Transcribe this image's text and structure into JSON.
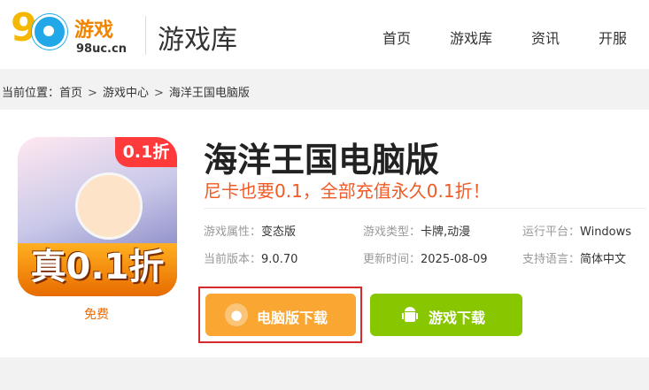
{
  "header": {
    "logo_big": "9",
    "logo_cn": "游戏",
    "logo_url": "98uc.cn",
    "site_title": "游戏库",
    "nav": [
      "首页",
      "游戏库",
      "资讯",
      "开服"
    ]
  },
  "breadcrumb": {
    "prefix": "当前位置：",
    "items": [
      "首页",
      "游戏中心",
      "海洋王国电脑版"
    ],
    "separator": ">"
  },
  "game": {
    "icon_tag": "0.1折",
    "icon_big": "真0.1折",
    "price": "免费",
    "title": "海洋王国电脑版",
    "promo": "尼卡也要0.1，全部充值永久0.1折！",
    "meta": [
      {
        "label": "游戏属性：",
        "value": "变态版"
      },
      {
        "label": "游戏类型：",
        "value": "卡牌,动漫"
      },
      {
        "label": "运行平台：",
        "value": "Windows"
      },
      {
        "label": "当前版本：",
        "value": "9.0.70"
      },
      {
        "label": "更新时间：",
        "value": "2025-08-09"
      },
      {
        "label": "支持语言：",
        "value": "简体中文"
      }
    ]
  },
  "buttons": {
    "pc_download": "电脑版下载",
    "game_download": "游戏下载",
    "pc_icon": "gamepad-icon",
    "game_icon": "android-icon"
  },
  "colors": {
    "accent_orange": "#f9a632",
    "accent_green": "#88c700",
    "promo": "#f15a24",
    "highlight_border": "#d72b2b"
  }
}
